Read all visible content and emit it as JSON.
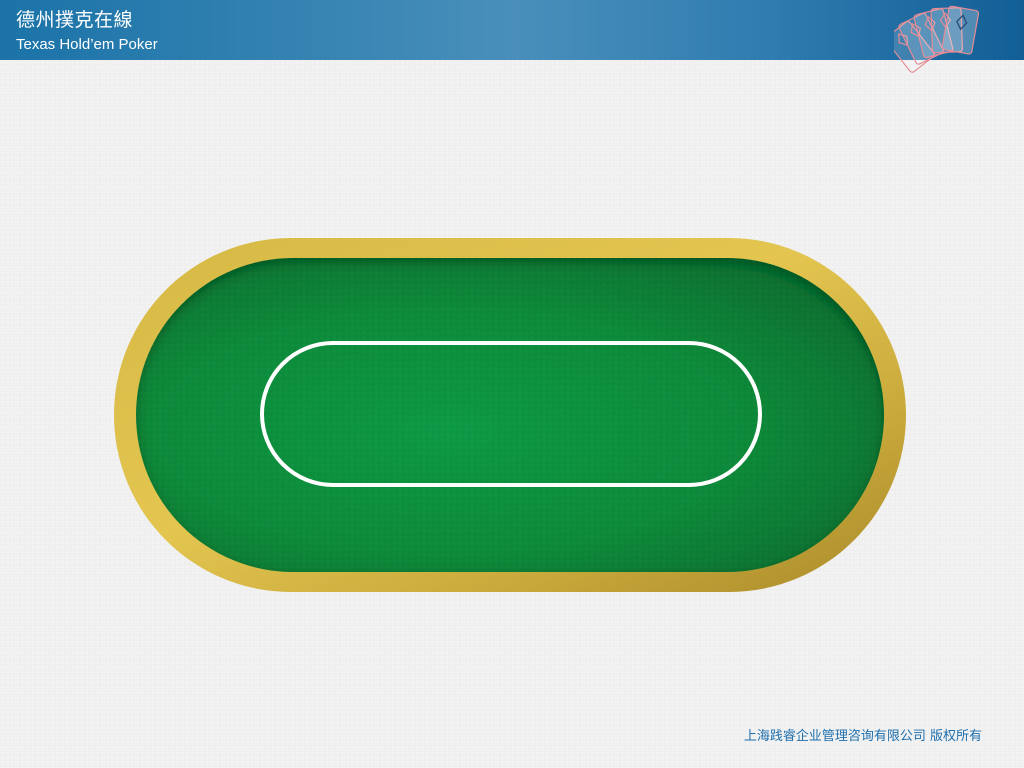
{
  "header": {
    "title_zh": "德州撲克在線",
    "title_en": "Texas Hold’em Poker"
  },
  "decoration": {
    "corner_icon": "playing-cards-fan-icon"
  },
  "table": {
    "felt_color": "#0b8a3a",
    "rail_color": "#c9a83a",
    "line_color": "#ffffff"
  },
  "footer": {
    "copyright": "上海践睿企业管理咨询有限公司 版权所有"
  },
  "colors": {
    "header_start": "#1b73a8",
    "header_end": "#115f96",
    "footer_text": "#1e6fae",
    "background": "#f1f1f1"
  }
}
